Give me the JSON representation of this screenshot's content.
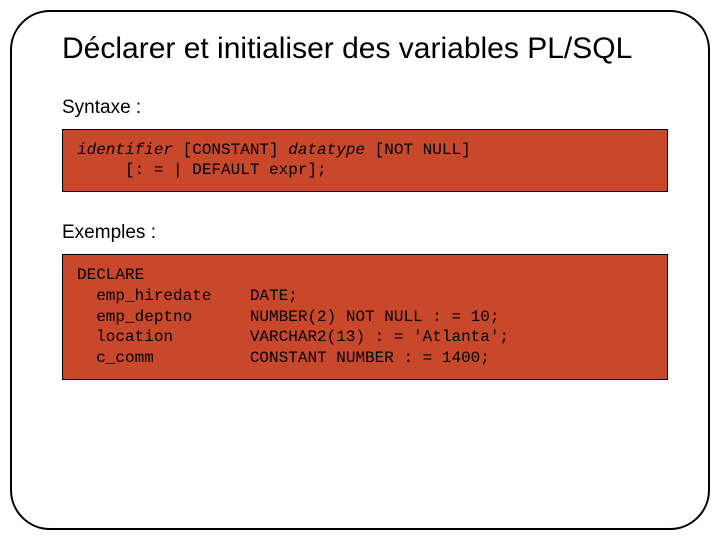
{
  "title": "Déclarer et initialiser des variables PL/SQL",
  "sections": {
    "syntax": {
      "label": "Syntaxe :",
      "code": {
        "ident": "identifier",
        "const": " [CONSTANT] ",
        "dtype": "datatype",
        "notnull": " [NOT NULL]",
        "line2": "     [: = | DEFAULT expr];"
      }
    },
    "examples": {
      "label": "Exemples :",
      "code": "DECLARE\n  emp_hiredate    DATE;\n  emp_deptno      NUMBER(2) NOT NULL : = 10;\n  location        VARCHAR2(13) : = 'Atlanta';\n  c_comm          CONSTANT NUMBER : = 1400;"
    }
  }
}
